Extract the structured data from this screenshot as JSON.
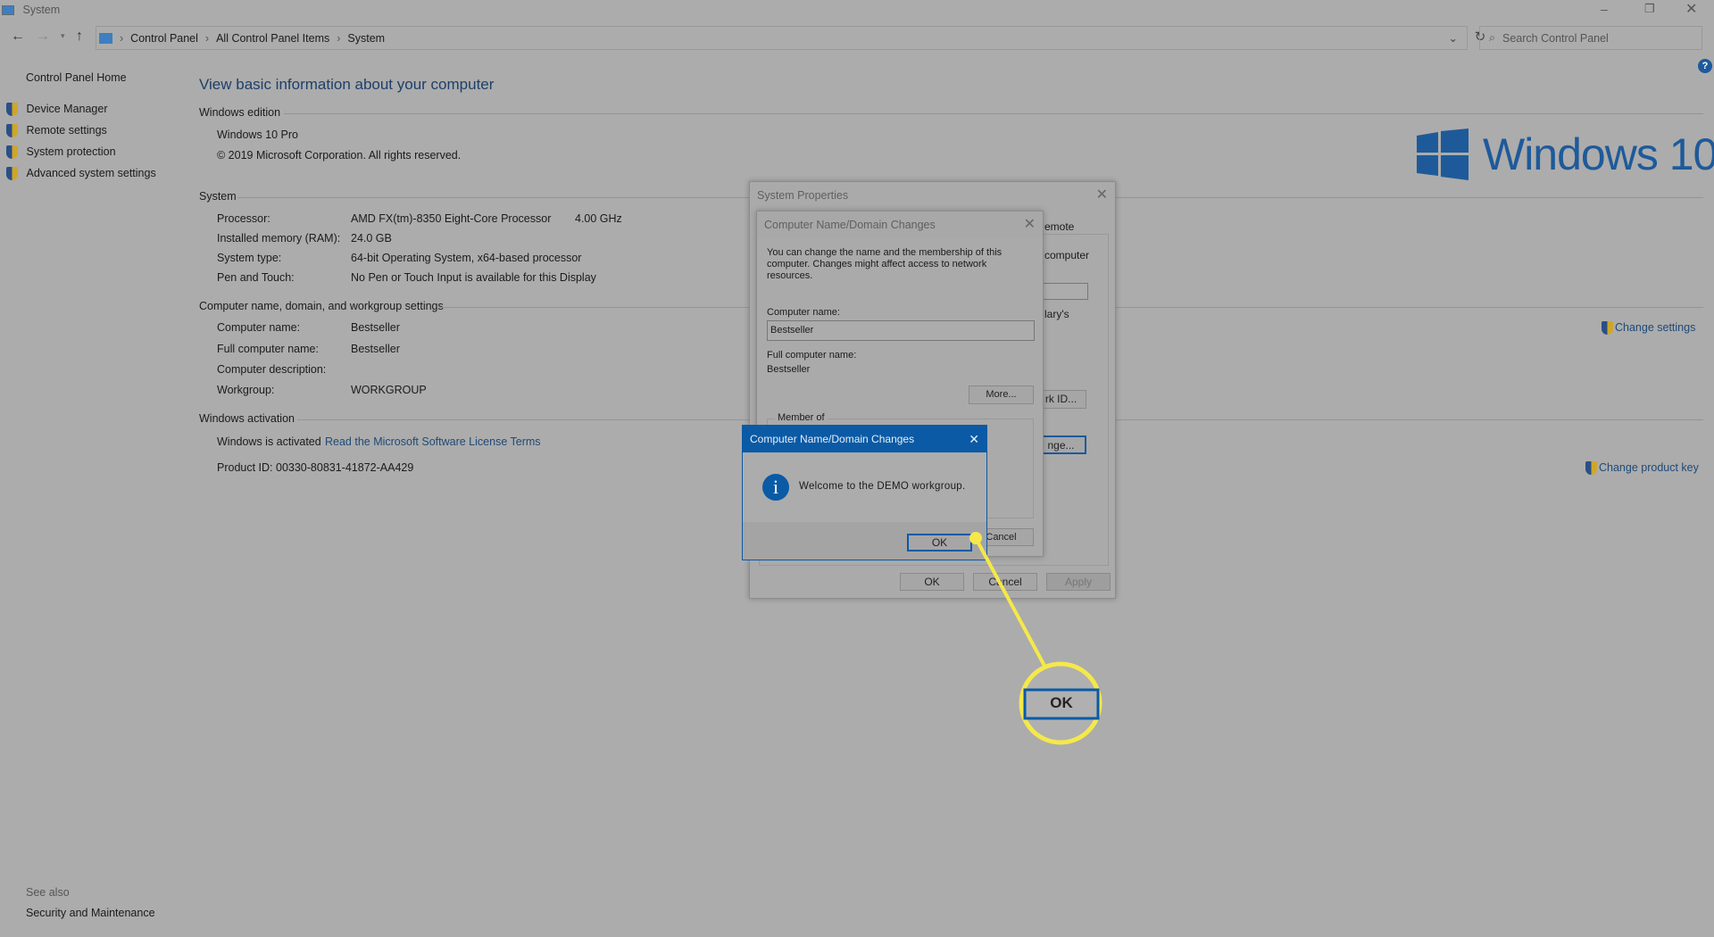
{
  "window": {
    "title": "System"
  },
  "nav": {
    "breadcrumb": [
      "Control Panel",
      "All Control Panel Items",
      "System"
    ],
    "search_placeholder": "Search Control Panel"
  },
  "sidebar": {
    "home": "Control Panel Home",
    "items": [
      {
        "label": "Device Manager"
      },
      {
        "label": "Remote settings"
      },
      {
        "label": "System protection"
      },
      {
        "label": "Advanced system settings"
      }
    ],
    "see_also": "See also",
    "security": "Security and Maintenance"
  },
  "main": {
    "heading": "View basic information about your computer",
    "edition": {
      "title": "Windows edition",
      "name": "Windows 10 Pro",
      "copyright": "© 2019 Microsoft Corporation. All rights reserved."
    },
    "logo_text": "Windows 10",
    "system": {
      "title": "System",
      "rows": [
        {
          "label": "Processor:",
          "value": "AMD FX(tm)-8350 Eight-Core Processor",
          "extra": "4.00 GHz"
        },
        {
          "label": "Installed memory (RAM):",
          "value": "24.0 GB"
        },
        {
          "label": "System type:",
          "value": "64-bit Operating System, x64-based processor"
        },
        {
          "label": "Pen and Touch:",
          "value": "No Pen or Touch Input is available for this Display"
        }
      ]
    },
    "computer": {
      "title": "Computer name, domain, and workgroup settings",
      "change": "Change settings",
      "rows": [
        {
          "label": "Computer name:",
          "value": "Bestseller"
        },
        {
          "label": "Full computer name:",
          "value": "Bestseller"
        },
        {
          "label": "Computer description:",
          "value": ""
        },
        {
          "label": "Workgroup:",
          "value": "WORKGROUP"
        }
      ]
    },
    "activation": {
      "title": "Windows activation",
      "status": "Windows is activated",
      "license_link": "Read the Microsoft Software License Terms",
      "product_id": "Product ID: 00330-80831-41872-AA429",
      "change_key": "Change product key"
    }
  },
  "sysprops": {
    "title": "System Properties",
    "tab_partial": "emote",
    "text1": "computer",
    "text2": "lary's",
    "netid": "rk ID...",
    "change": "nge...",
    "ok": "OK",
    "cancel": "Cancel",
    "apply": "Apply"
  },
  "cndc": {
    "title": "Computer Name/Domain Changes",
    "desc": "You can change the name and the membership of this computer. Changes might affect access to network resources.",
    "name_label": "Computer name:",
    "name_value": "Bestseller",
    "full_label": "Full computer name:",
    "full_value": "Bestseller",
    "more": "More...",
    "member_of": "Member of",
    "cancel": "Cancel"
  },
  "msgbox": {
    "title": "Computer Name/Domain Changes",
    "message": "Welcome to the DEMO workgroup.",
    "ok": "OK",
    "accent": "#0a5aa6"
  },
  "callout": {
    "label": "OK",
    "color": "#f5e84a"
  }
}
